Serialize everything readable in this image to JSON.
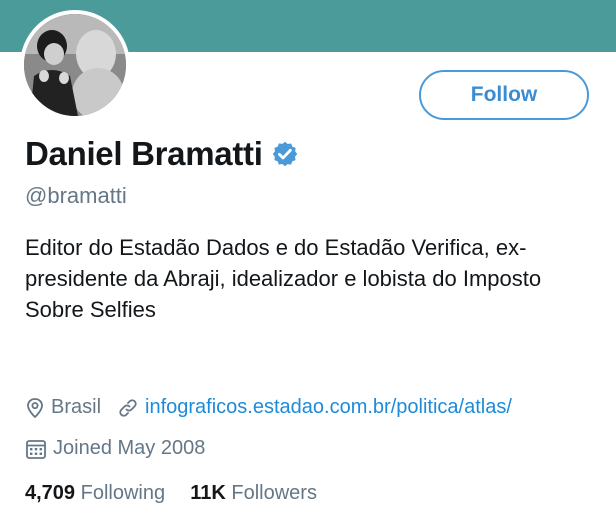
{
  "profile": {
    "name": "Daniel Bramatti",
    "handle": "@bramatti",
    "bio": "Editor do Estadão Dados e do Estadão Verifica, ex-presidente da Abraji, idealizador e lobista do Imposto Sobre Selfies",
    "location": "Brasil",
    "website": "infograficos.estadao.com.br/politica/atlas/",
    "joined": "Joined May 2008",
    "following_count": "4,709",
    "following_label": "Following",
    "followers_count": "11K",
    "followers_label": "Followers",
    "verified_icon": "verified-badge-icon"
  },
  "actions": {
    "follow_label": "Follow"
  },
  "colors": {
    "banner": "#4b9b9b",
    "accent": "#1d8bd8",
    "muted": "#657786"
  }
}
